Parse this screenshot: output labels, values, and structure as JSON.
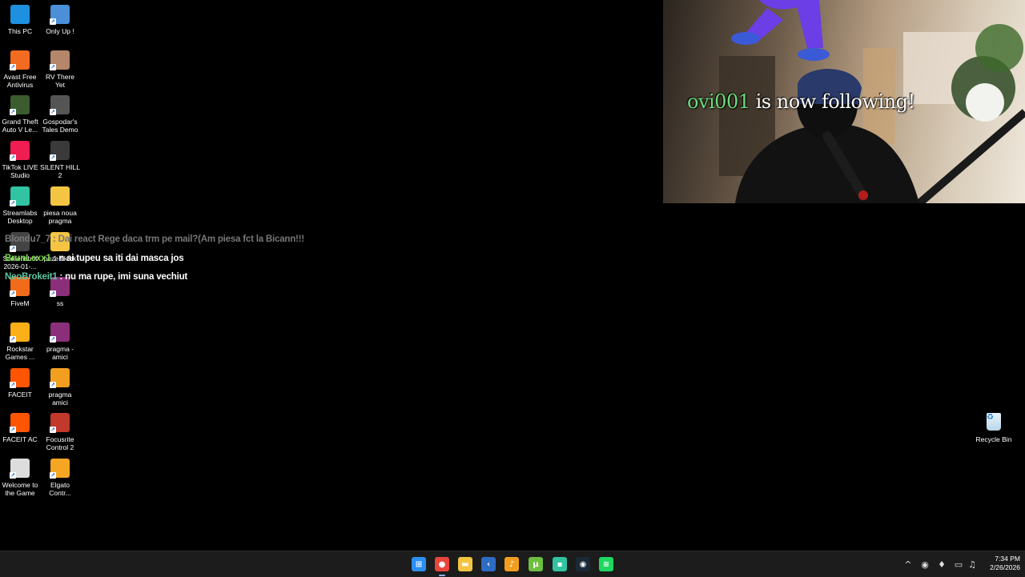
{
  "desktop_icons": [
    {
      "label": "This PC",
      "icon": "monitor-icon",
      "color": "#1e90e0"
    },
    {
      "label": "Only Up !",
      "icon": "game-icon",
      "color": "#4a8fd8"
    },
    {
      "label": "Avast Free\nAntivirus",
      "icon": "avast-icon",
      "color": "#f26b21"
    },
    {
      "label": "RV There Yet",
      "icon": "game-icon",
      "color": "#b4876a"
    },
    {
      "label": "Grand Theft\nAuto V Le...",
      "icon": "gta-icon",
      "color": "#3b5c2e"
    },
    {
      "label": "Gospodar's\nTales Demo",
      "icon": "game-icon",
      "color": "#555555"
    },
    {
      "label": "TikTok LIVE\nStudio",
      "icon": "tiktok-icon",
      "color": "#ee1d52"
    },
    {
      "label": "SILENT HILL\n2",
      "icon": "game-icon",
      "color": "#3a3a3a"
    },
    {
      "label": "Streamlabs\nDesktop",
      "icon": "streamlabs-icon",
      "color": "#31c3a2"
    },
    {
      "label": "piesa noua\npragma",
      "icon": "folder-icon",
      "color": "#f4c542"
    },
    {
      "label": "Screenshot\n2026-01-...",
      "icon": "image-icon",
      "color": "#444444"
    },
    {
      "label": "poze tiktok",
      "icon": "folder-icon",
      "color": "#f4c542"
    },
    {
      "label": "FiveM",
      "icon": "fivem-icon",
      "color": "#f06c1a"
    },
    {
      "label": "ss",
      "icon": "winrar-icon",
      "color": "#8b2f7a"
    },
    {
      "label": "Rockstar\nGames ...",
      "icon": "rockstar-icon",
      "color": "#fcaf17"
    },
    {
      "label": "pragma -\namici",
      "icon": "winrar-icon",
      "color": "#8b2f7a"
    },
    {
      "label": "FACEIT",
      "icon": "faceit-icon",
      "color": "#ff5500"
    },
    {
      "label": "pragma\namici",
      "icon": "flstudio-icon",
      "color": "#f29e1f"
    },
    {
      "label": "FACEIT AC",
      "icon": "faceit-ac-icon",
      "color": "#ff5500"
    },
    {
      "label": "Focusrite\nControl 2",
      "icon": "focusrite-icon",
      "color": "#c0392b"
    },
    {
      "label": "Welcome to\nthe Game",
      "icon": "skull-icon",
      "color": "#dddddd"
    },
    {
      "label": "Elgato\nContr...",
      "icon": "elgato-icon",
      "color": "#f5a623"
    }
  ],
  "chat": [
    {
      "user": "Blondu7_7",
      "sep": " : ",
      "text": "Dai react Rege daca trm pe mail?(Am piesa fct la Bicann!!!",
      "user_color": "#7a7a7a",
      "faded": true
    },
    {
      "user": "BrunLexx1",
      "sep": " : ",
      "text": "n ai tupeu sa iti dai masca jos",
      "user_color": "#7bd94b",
      "faded": false
    },
    {
      "user": "NeoBrokeit1",
      "sep": " : ",
      "text": "nu ma rupe, imi suna vechiut",
      "user_color": "#5cc7a4",
      "faded": false
    }
  ],
  "webcam": {
    "follow_user": "ovi001",
    "follow_text": " is now following!"
  },
  "recycle_bin": {
    "label": "Recycle Bin",
    "icon": "recycle-bin-icon"
  },
  "taskbar": {
    "apps": [
      {
        "name": "start",
        "icon": "windows-icon",
        "color": "#2b8ef0",
        "glyph": "⊞"
      },
      {
        "name": "chrome",
        "icon": "chrome-icon",
        "color": "#e8453c",
        "glyph": "●",
        "active": true
      },
      {
        "name": "file-explorer",
        "icon": "folder-icon",
        "color": "#f4c542",
        "glyph": "▬"
      },
      {
        "name": "visual-studio-code",
        "icon": "code-icon",
        "color": "#2c6cc4",
        "glyph": "‹"
      },
      {
        "name": "fl-studio",
        "icon": "flstudio-icon",
        "color": "#f29e1f",
        "glyph": "♪"
      },
      {
        "name": "utorrent",
        "icon": "utorrent-icon",
        "color": "#6cbf3f",
        "glyph": "µ"
      },
      {
        "name": "streamlabs",
        "icon": "streamlabs-icon",
        "color": "#31c3a2",
        "glyph": "▪"
      },
      {
        "name": "steam",
        "icon": "steam-icon",
        "color": "#1b2838",
        "glyph": "◉"
      },
      {
        "name": "spotify",
        "icon": "spotify-icon",
        "color": "#1ed760",
        "glyph": "≋"
      }
    ],
    "tray": [
      {
        "icon": "chevron-up-icon",
        "glyph": "^"
      },
      {
        "icon": "record-icon",
        "glyph": "◉"
      },
      {
        "icon": "microphone-icon",
        "glyph": "♦"
      },
      {
        "icon": "network-icon",
        "glyph": "▭"
      },
      {
        "icon": "volume-icon",
        "glyph": "♫"
      }
    ],
    "time": "7:34 PM",
    "date": "2/26/2026"
  }
}
